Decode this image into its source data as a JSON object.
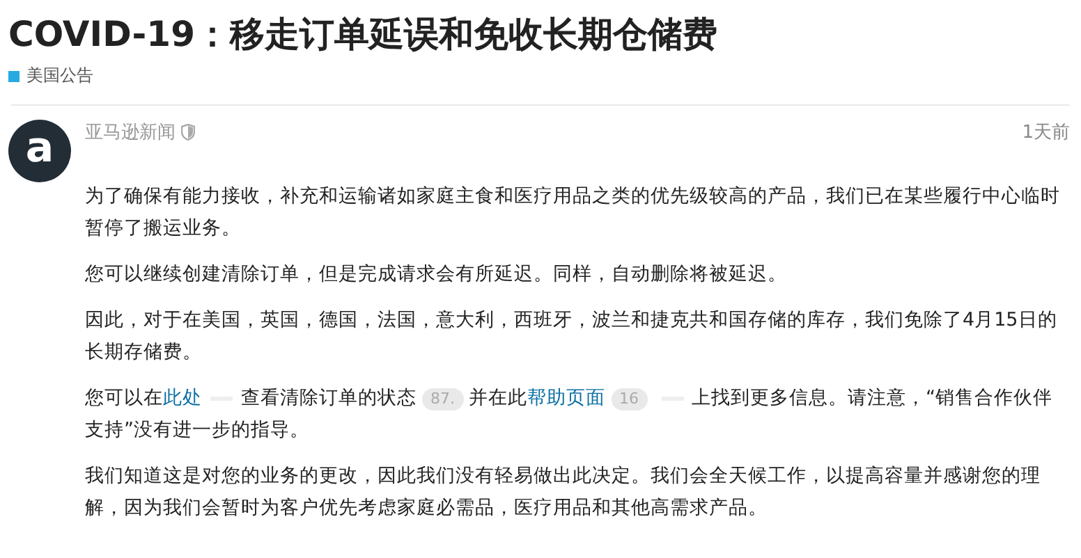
{
  "title": "COVID-19：移走订单延误和免收长期仓储费",
  "category": {
    "label": "美国公告",
    "color": "#25aae2"
  },
  "post": {
    "author": "亚马逊新闻",
    "time": "1天前",
    "avatar": "a",
    "paragraphs": [
      [
        {
          "kind": "text",
          "text": "为了确保有能力接收，补充和运输诸如家庭主食和医疗用品之类的优先级较高的产品，我们已在某些履行中心临时暂停了搬运业务。"
        }
      ],
      [
        {
          "kind": "text",
          "text": "您可以继续创建清除订单，但是完成请求会有所延迟。同样，自动删除将被延迟。"
        }
      ],
      [
        {
          "kind": "text",
          "text": "因此，对于在美国，英国，德国，法国，意大利，西班牙，波兰和捷克共和国存储的库存，我们免除了4月15日的长期存储费。"
        }
      ],
      [
        {
          "kind": "text",
          "text": "您可以在"
        },
        {
          "kind": "link",
          "text": "此处"
        },
        {
          "kind": "gap"
        },
        {
          "kind": "text",
          "text": "查看清除订单的状态"
        },
        {
          "kind": "badge",
          "text": "87."
        },
        {
          "kind": "text",
          "text": "并在此"
        },
        {
          "kind": "link",
          "text": "帮助页面"
        },
        {
          "kind": "badge",
          "text": "16"
        },
        {
          "kind": "gap"
        },
        {
          "kind": "text",
          "text": "上找到更多信息。请注意，“销售合作伙伴支持”没有进一步的指导。"
        }
      ],
      [
        {
          "kind": "text",
          "text": "我们知道这是对您的业务的更改，因此我们没有轻易做出此决定。我们会全天候工作，以提高容量并感谢您的理解，因为我们会暂时为客户优先考虑家庭必需品，医疗用品和其他高需求产品。"
        }
      ]
    ]
  }
}
